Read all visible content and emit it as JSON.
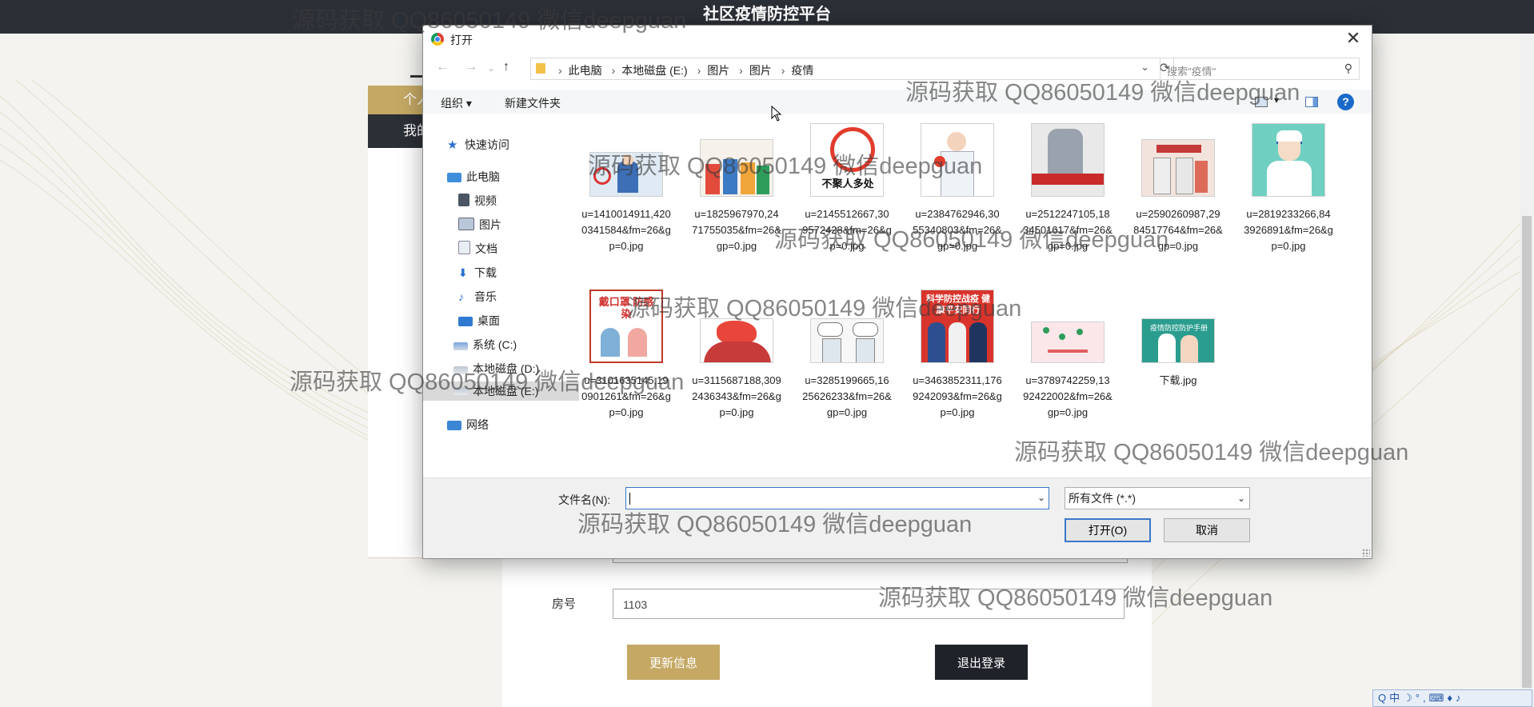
{
  "page": {
    "title": "社区疫情防控平台",
    "left_tab_top": "个人",
    "left_tab_second": "我的",
    "room_label": "房号",
    "room_value": "1103",
    "update_button": "更新信息",
    "logout_button": "退出登录"
  },
  "dialog": {
    "title": "打开",
    "close_glyph": "✕",
    "nav": {
      "back": "←",
      "forward": "→",
      "recent": "⌄",
      "up": "↑"
    },
    "breadcrumb": [
      "此电脑",
      "本地磁盘 (E:)",
      "图片",
      "图片",
      "疫情"
    ],
    "search_placeholder": "搜索\"疫情\"",
    "toolbar": {
      "organize": "组织 ▾",
      "new_folder": "新建文件夹"
    },
    "sidebar": [
      {
        "label": "快速访问",
        "icon": "star-icon"
      },
      {
        "label": "此电脑",
        "icon": "computer-icon"
      },
      {
        "label": "视频",
        "icon": "video-icon"
      },
      {
        "label": "图片",
        "icon": "pictures-icon"
      },
      {
        "label": "文档",
        "icon": "documents-icon"
      },
      {
        "label": "下载",
        "icon": "download-icon"
      },
      {
        "label": "音乐",
        "icon": "music-icon"
      },
      {
        "label": "桌面",
        "icon": "desktop-icon"
      },
      {
        "label": "系统 (C:)",
        "icon": "drive-icon"
      },
      {
        "label": "本地磁盘 (D:)",
        "icon": "drive-icon"
      },
      {
        "label": "本地磁盘 (E:)",
        "icon": "drive-icon"
      },
      {
        "label": "网络",
        "icon": "network-icon"
      }
    ],
    "files": [
      {
        "name": "u=1410014911,4200341584&fm=26&gp=0.jpg"
      },
      {
        "name": "u=1825967970,2471755035&fm=26&gp=0.jpg"
      },
      {
        "name": "u=2145512667,309572428&fm=26&gp=0.jpg"
      },
      {
        "name": "u=2384762946,3055340803&fm=26&gp=0.jpg"
      },
      {
        "name": "u=2512247105,1834501617&fm=26&gp=0.jpg"
      },
      {
        "name": "u=2590260987,2984517764&fm=26&gp=0.jpg"
      },
      {
        "name": "u=2819233266,843926891&fm=26&gp=0.jpg"
      },
      {
        "name": "u=3101635145,190901261&fm=26&gp=0.jpg"
      },
      {
        "name": "u=3115687188,3092436343&fm=26&gp=0.jpg"
      },
      {
        "name": "u=3285199665,1625626233&fm=26&gp=0.jpg"
      },
      {
        "name": "u=3463852311,1769242093&fm=26&gp=0.jpg"
      },
      {
        "name": "u=3789742259,1392422002&fm=26&gp=0.jpg"
      },
      {
        "name": "下载.jpg"
      }
    ],
    "filename_label": "文件名(N):",
    "filename_value": "",
    "file_type_filter": "所有文件 (*.*)",
    "open_button": "打开(O)",
    "cancel_button": "取消",
    "thumb_text": {
      "no_gathering": "不聚人多处",
      "mask": "戴口罩 防感染",
      "science": "科学防控战疫 健康平安同行",
      "handbook": "疫情防控防护手册"
    }
  },
  "ime": {
    "text": "Q中☽°,⌨♦♪"
  },
  "watermark": "源码获取 QQ86050149 微信deepguan",
  "colors": {
    "accent_gold": "#c4a864",
    "dark": "#2b2f36",
    "link_blue": "#3a78c9"
  }
}
